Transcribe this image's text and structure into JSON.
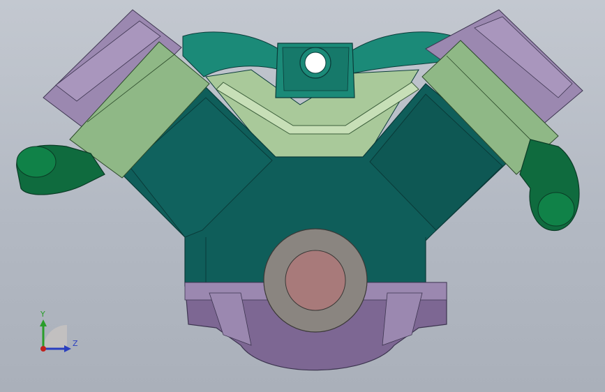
{
  "viewport": {
    "background_top": "#c3c8d0",
    "background_bottom": "#aab0ba"
  },
  "model": {
    "colors": {
      "block": "#0f5e5a",
      "block_edge": "#0a3b39",
      "sleeve": "#8fb886",
      "head_cover": "#9b88b0",
      "oil_pan": "#7d6793",
      "manifold": "#1b8a78",
      "exhaust_pipe": "#0f6b3e",
      "bearing_ring": "#8a8580",
      "bearing_core": "#a87a7a"
    }
  },
  "triad": {
    "axes": [
      {
        "name": "y-axis",
        "label": "Y",
        "color": "#2a9d2a"
      },
      {
        "name": "z-axis",
        "label": "Z",
        "color": "#2a3fbf"
      },
      {
        "name": "x-axis",
        "label": "",
        "color": "#c0201c"
      }
    ]
  }
}
